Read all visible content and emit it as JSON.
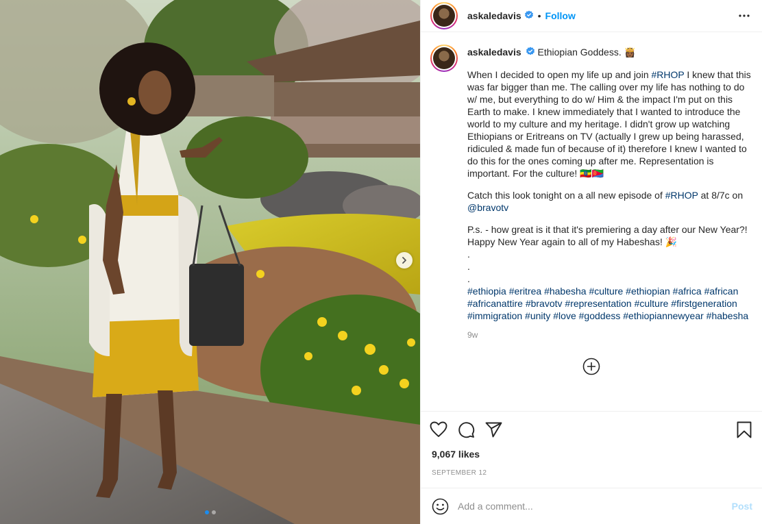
{
  "header": {
    "username": "askaledavis",
    "separator": "•",
    "follow_label": "Follow"
  },
  "caption": {
    "username": "askaledavis",
    "title": "Ethiopian Goddess. 👸🏾",
    "p1_a": "When I decided to open my life up and join ",
    "p1_tag": "#RHOP",
    "p1_b": " I knew that this was far bigger than me. The calling over my life has nothing to do w/ me, but everything to do w/ Him & the impact I'm put on this Earth to make. I knew immediately that I wanted to introduce the world to my culture and my heritage. I didn't grow up watching Ethiopians or Eritreans on TV (actually I grew up being harassed, ridiculed & made fun of because of it) therefore I knew I wanted to do this for the ones coming up after me. Representation is important. For the culture! 🇪🇹🇪🇷",
    "p2_a": "Catch this look tonight on a all new episode of ",
    "p2_tag": "#RHOP",
    "p2_b": " at 8/7c on ",
    "p2_mention": "@bravotv",
    "p3": "P.s. - how great is it that it's premiering a day after our New Year?! Happy New Year again to all of my Habeshas! 🎉",
    "dots": ".\n.\n.",
    "hashtags": "#ethiopia #eritrea #habesha #culture #ethiopian #africa #african #africanattire #bravotv #representation #culture #firstgeneration #immigration #unity #love #goddess #ethiopiannewyear #habesha",
    "time_ago": "9w"
  },
  "actions": {
    "likes": "9,067 likes",
    "date": "SEPTEMBER 12"
  },
  "comment_box": {
    "placeholder": "Add a comment...",
    "post_label": "Post"
  },
  "icons": {
    "verified": "verified-badge-icon",
    "more": "more-options-icon",
    "like": "heart-icon",
    "comment": "comment-bubble-icon",
    "share": "paper-plane-icon",
    "save": "bookmark-icon",
    "emoji": "emoji-icon",
    "load_more": "plus-circle-icon",
    "next": "chevron-right-icon"
  },
  "colors": {
    "accent": "#0095f6",
    "hashtag": "#00376b",
    "muted": "#8e8e8e",
    "post_disabled": "#b2dffc"
  },
  "carousel": {
    "current_index": 1,
    "total": 2
  }
}
